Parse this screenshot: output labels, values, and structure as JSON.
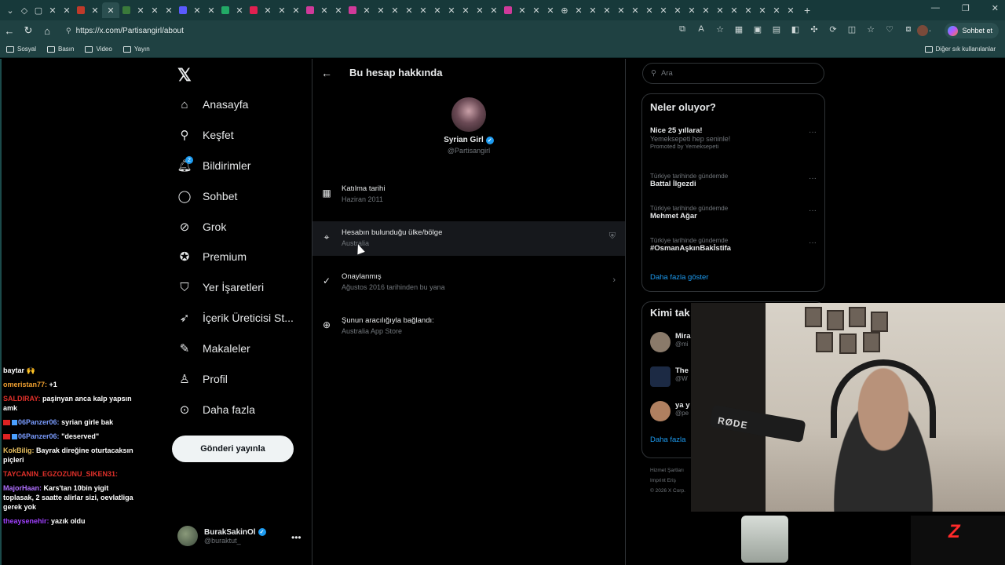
{
  "browser": {
    "url": "https://x.com/Partisangirl/about",
    "copilot_label": "Sohbet et",
    "bookmarks": [
      "Sosyal",
      "Basın",
      "Video",
      "Yayın"
    ],
    "other_bookmarks": "Diğer sık kullanılanlar"
  },
  "nav": {
    "items": [
      {
        "label": "Anasayfa",
        "icon": "home-icon"
      },
      {
        "label": "Keşfet",
        "icon": "search-icon"
      },
      {
        "label": "Bildirimler",
        "icon": "bell-icon",
        "badge": "2"
      },
      {
        "label": "Sohbet",
        "icon": "chat-icon"
      },
      {
        "label": "Grok",
        "icon": "grok-icon"
      },
      {
        "label": "Premium",
        "icon": "premium-icon"
      },
      {
        "label": "Yer İşaretleri",
        "icon": "bookmark-icon"
      },
      {
        "label": "İçerik Üreticisi St...",
        "icon": "rocket-icon"
      },
      {
        "label": "Makaleler",
        "icon": "article-icon"
      },
      {
        "label": "Profil",
        "icon": "person-icon"
      },
      {
        "label": "Daha fazla",
        "icon": "more-icon"
      }
    ],
    "post_button": "Gönderi yayınla",
    "account": {
      "name": "BurakSakinOl",
      "handle": "@buraktut_"
    }
  },
  "about": {
    "title": "Bu hesap hakkında",
    "name": "Syrian Girl",
    "handle": "@Partisangirl",
    "rows": [
      {
        "title": "Katılma tarihi",
        "value": "Haziran 2011",
        "icon": "calendar-icon"
      },
      {
        "title": "Hesabın bulunduğu ülke/bölge",
        "value": "Australia",
        "icon": "location-icon"
      },
      {
        "title": "Onaylanmış",
        "value": "Ağustos 2016 tarihinden bu yana",
        "icon": "verified-check-icon"
      },
      {
        "title": "Şunun aracılığıyla bağlandı:",
        "value": "Australia App Store",
        "icon": "globe-icon"
      }
    ]
  },
  "search": {
    "placeholder": "Ara"
  },
  "trends": {
    "title": "Neler oluyor?",
    "promo": {
      "title": "Nice 25 yıllara!",
      "sub": "Yemeksepeti hep seninle!",
      "promoted": "Promoted by Yemeksepeti"
    },
    "items": [
      {
        "context": "Türkiye tarihinde gündemde",
        "title": "Battal İlgezdi"
      },
      {
        "context": "Türkiye tarihinde gündemde",
        "title": "Mehmet Ağar"
      },
      {
        "context": "Türkiye tarihinde gündemde",
        "title": "#OsmanAşkınBakİstifa"
      }
    ],
    "show_more": "Daha fazla göster"
  },
  "who_to_follow": {
    "title": "Kimi tak",
    "items": [
      {
        "name": "Mira",
        "handle": "@mi"
      },
      {
        "name": "The",
        "handle": "@W"
      },
      {
        "name": "ya y",
        "handle": "@pe"
      }
    ],
    "show_more": "Daha fazla"
  },
  "footer": [
    "Hizmet Şartları",
    "Imprint   Eriş",
    "© 2026 X Corp."
  ],
  "chat": [
    {
      "user": "",
      "text": "baytar 🙌",
      "cls": ""
    },
    {
      "user": "omeristan77:",
      "text": "+1",
      "cls": "u-orange"
    },
    {
      "user": "SALDIRAY:",
      "text": "paşinyan anca kalp yapsın amk",
      "cls": "u-red"
    },
    {
      "user": "06Panzer06:",
      "text": "syrian girle bak",
      "cls": "u-blue"
    },
    {
      "user": "06Panzer06:",
      "text": "\"deserved\"",
      "cls": "u-blue"
    },
    {
      "user": "KokBilig:",
      "text": "Bayrak direğine oturtacaksın piçleri",
      "cls": "u-gold"
    },
    {
      "user": "TAYCANIN_EGZOZUNU_SIKEN31:",
      "text": "",
      "cls": "u-red"
    },
    {
      "user": "MajorHaan:",
      "text": "Kars'tan 10bin yigit toplasak, 2 saatte alirlar sizi, oevlatliga gerek yok",
      "cls": "u-purple"
    },
    {
      "user": "theaysenehir:",
      "text": "yazık oldu",
      "cls": "u-violet"
    }
  ],
  "overlay": {
    "mic_brand": "RØDE"
  }
}
